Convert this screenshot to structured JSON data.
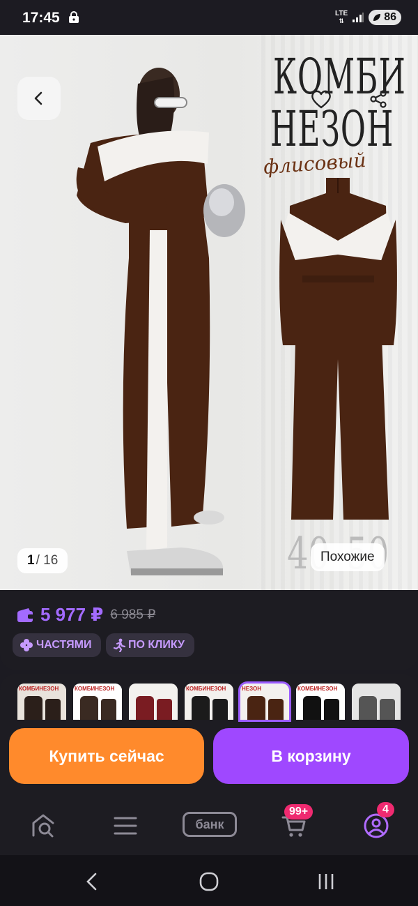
{
  "status_bar": {
    "time": "17:45",
    "network": "LTE",
    "battery": "86"
  },
  "hero": {
    "title_line1": "КОМБИ",
    "title_line2": "НЕЗОН",
    "script_text": "флисовый",
    "sizes_text": "40–50",
    "page_current": "1",
    "page_total": "/ 16",
    "similar_label": "Похожие",
    "back_icon": "chevron-left-icon",
    "favorite_icon": "heart-icon",
    "share_icon": "share-icon"
  },
  "price": {
    "current": "5 977 ₽",
    "old": "6 985 ₽",
    "wallet_icon": "wallet-icon",
    "color_accent": "#a36bff"
  },
  "pills": {
    "parts_label": "ЧАСТЯМИ",
    "click_label": "ПО КЛИКУ"
  },
  "thumbnails": [
    {
      "label": "КОМБИНЕЗОН",
      "selected": false
    },
    {
      "label": "КОМБИНЕЗОН",
      "selected": false
    },
    {
      "label": "",
      "selected": false
    },
    {
      "label": "КОМБИНЕЗОН",
      "selected": false
    },
    {
      "label": "НЕЗОН",
      "selected": true
    },
    {
      "label": "КОМБИНЕЗОН",
      "selected": false
    },
    {
      "label": "",
      "selected": false
    }
  ],
  "actions": {
    "buy_now": "Купить сейчас",
    "add_to_cart": "В корзину",
    "buy_color": "#ff8a2c",
    "cart_color": "#9f48ff"
  },
  "bottom_nav": {
    "bank_label": "банк",
    "cart_badge": "99+",
    "profile_badge": "4"
  }
}
